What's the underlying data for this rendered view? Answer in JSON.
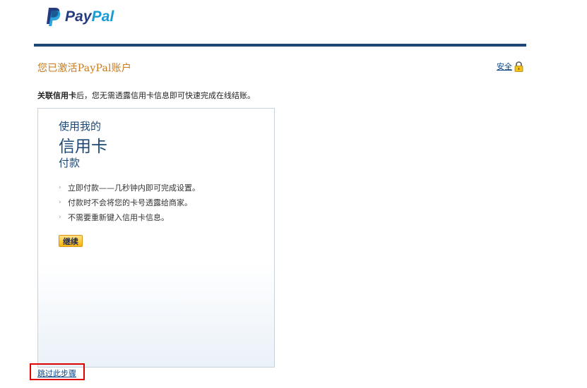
{
  "brand": {
    "logo_pay": "Pay",
    "logo_pal": "Pal",
    "colors": {
      "navy": "#253b80",
      "sky": "#179bd7",
      "header_bar": "#1d4775",
      "title_orange": "#c87a1c"
    }
  },
  "header": {
    "title": "您已激活PayPal账户",
    "security_label": "安全",
    "security_icon": "lock-icon"
  },
  "intro": {
    "bold": "关联信用卡",
    "text": "后，您无需透露信用卡信息即可快速完成在线结账。"
  },
  "promo": {
    "line1": "使用我的",
    "line2": "信用卡",
    "line3": "付款",
    "benefits": [
      "立即付款——几秒钟内即可完成设置。",
      "付款时不会将您的卡号透露给商家。",
      "不需要重新键入信用卡信息。"
    ],
    "button_label": "继续"
  },
  "footer": {
    "skip_label": "跳过此步骤"
  }
}
